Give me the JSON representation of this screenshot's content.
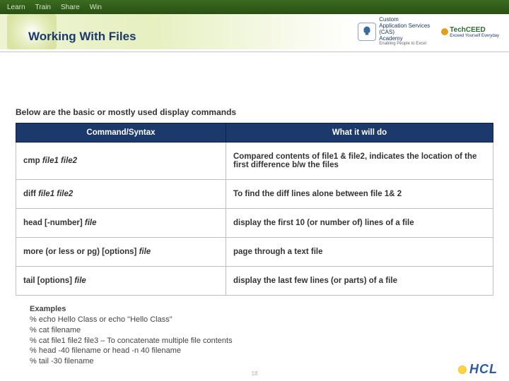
{
  "topbar": {
    "items": [
      "Learn",
      "Train",
      "Share",
      "Win"
    ]
  },
  "header_logos": {
    "cas_line1": "Custom",
    "cas_line2": "Application Services",
    "cas_line3": "(CAS)",
    "cas_line4": "Academy",
    "cas_tag": "Enabling People to Excel",
    "techceed": "TechCEED",
    "techceed_tag": "Exceed Yourself Everyday"
  },
  "slide_title": "Working With Files",
  "intro": "Below are the basic or mostly used display commands",
  "table": {
    "headers": {
      "cmd": "Command/Syntax",
      "desc": "What it will do"
    },
    "rows": [
      {
        "cmd_prefix": "cmp  ",
        "cmd_italic": "file1 file2",
        "desc": "Compared contents of file1 & file2, indicates the location of the first difference b/w the files"
      },
      {
        "cmd_prefix": "diff  ",
        "cmd_italic": "file1 file2",
        "desc": "To find the diff lines alone  between file 1& 2"
      },
      {
        "cmd_prefix": "head [-number] ",
        "cmd_italic": "file",
        "desc": "display the first 10 (or number of) lines of a file"
      },
      {
        "cmd_prefix": "more (or less or pg) [options] ",
        "cmd_italic": "file",
        "desc": "page through a text file"
      },
      {
        "cmd_prefix": "tail [options] ",
        "cmd_italic": "file",
        "desc": "display the last few lines (or parts) of a file"
      }
    ]
  },
  "examples": {
    "title": "Examples",
    "lines": [
      "% echo Hello Class or echo \"Hello Class\"",
      "% cat filename",
      "% cat file1 file2 file3 – To concatenate multiple file contents",
      "% head -40 filename or head -n 40 filename",
      "% tail -30 filename"
    ]
  },
  "footer": {
    "page_num": "18",
    "logo": "HCL"
  }
}
